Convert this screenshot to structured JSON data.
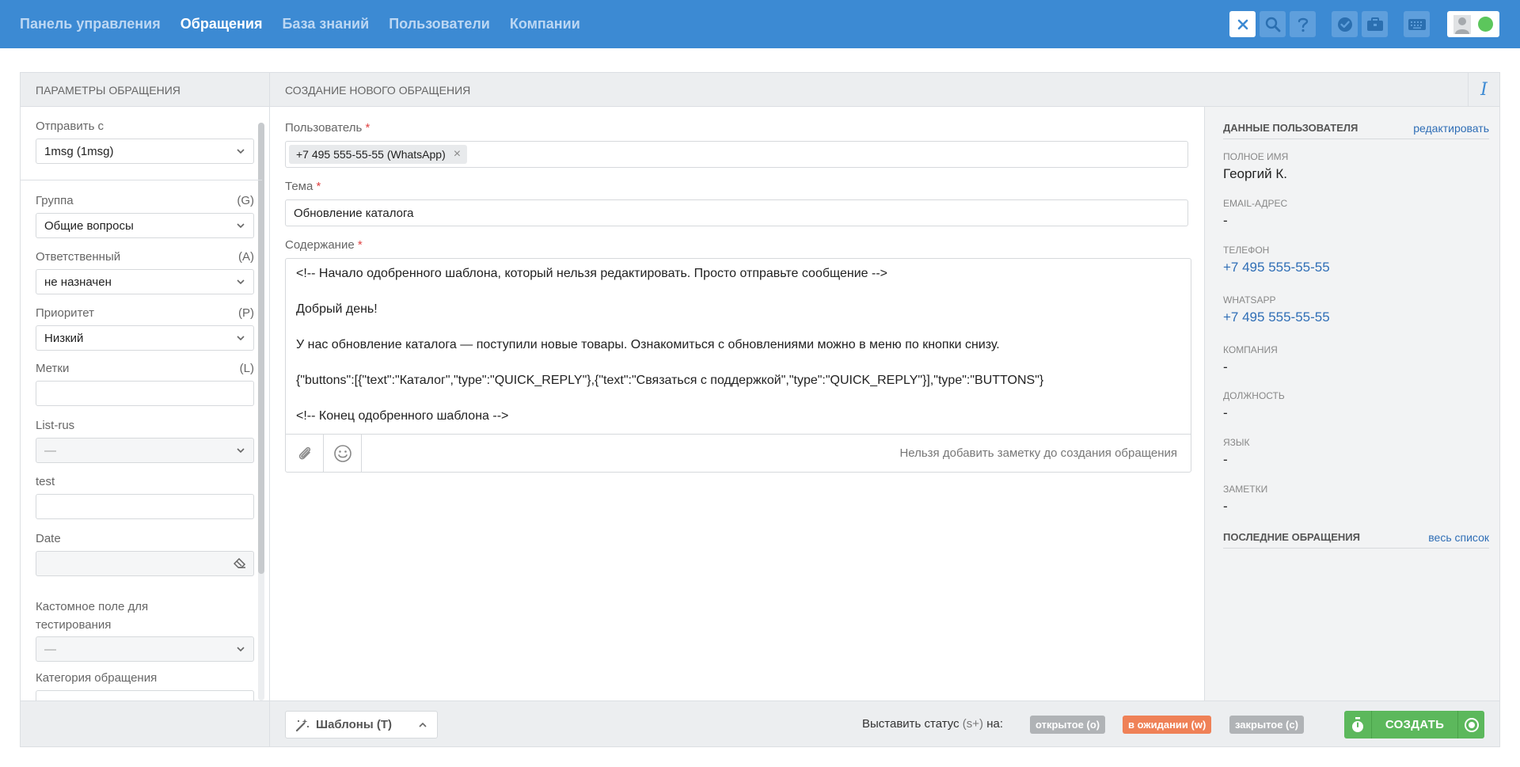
{
  "nav": {
    "items": [
      {
        "label": "Панель управления",
        "active": false
      },
      {
        "label": "Обращения",
        "active": true
      },
      {
        "label": "База знаний",
        "active": false
      },
      {
        "label": "Пользователи",
        "active": false
      },
      {
        "label": "Компании",
        "active": false
      }
    ]
  },
  "toolbar_icons": [
    "close-icon",
    "search-icon",
    "help-icon",
    "check-badge-icon",
    "briefcase-icon",
    "keyboard-icon",
    "avatar-icon"
  ],
  "headers": {
    "left": "Параметры обращения",
    "center": "Создание нового обращения",
    "info": "i"
  },
  "sidebar": {
    "send_from": {
      "label": "Отправить с",
      "value": "1msg (1msg)"
    },
    "group": {
      "label": "Группа",
      "hotkey": "(G)",
      "value": "Общие вопросы"
    },
    "assignee": {
      "label": "Ответственный",
      "hotkey": "(A)",
      "value": "не назначен"
    },
    "priority": {
      "label": "Приоритет",
      "hotkey": "(P)",
      "value": "Низкий"
    },
    "tags": {
      "label": "Метки",
      "hotkey": "(L)",
      "value": ""
    },
    "list_rus": {
      "label": "List-rus",
      "value": "—"
    },
    "test": {
      "label": "test",
      "value": ""
    },
    "date": {
      "label": "Date",
      "value": ""
    },
    "custom_field": {
      "label": "Кастомное поле для тестирования",
      "value": "—"
    },
    "category": {
      "label": "Категория обращения"
    }
  },
  "form": {
    "user_label": "Пользователь",
    "required_mark": "*",
    "user_token": "+7 495 555-55-55 (WhatsApp)",
    "token_remove": "×",
    "subject_label": "Тема",
    "subject_value": "Обновление каталога",
    "content_label": "Содержание",
    "content_lines": [
      "<!-- Начало одобренного шаблона, который нельзя редактировать. Просто отправьте сообщение -->",
      "Добрый день!",
      "У нас обновление каталога — поступили новые товары. Ознакомиться с обновлениями можно в меню по кнопки снизу.",
      "{\"buttons\":[{\"text\":\"Каталог\",\"type\":\"QUICK_REPLY\"},{\"text\":\"Связаться с поддержкой\",\"type\":\"QUICK_REPLY\"}],\"type\":\"BUTTONS\"}",
      "<!-- Конец одобренного шаблона -->"
    ],
    "note_disabled": "Нельзя добавить заметку до создания обращения"
  },
  "user_data": {
    "title": "Данные пользователя",
    "edit_link": "редактировать",
    "fields": [
      {
        "key": "Полное имя",
        "value": "Георгий К.",
        "link": false
      },
      {
        "key": "Email-адрес",
        "value": "-",
        "link": false
      },
      {
        "key": "Телефон",
        "value": "+7 495 555-55-55",
        "link": true
      },
      {
        "key": "WhatsApp",
        "value": "+7 495 555-55-55",
        "link": true
      },
      {
        "key": "Компания",
        "value": "-",
        "link": false
      },
      {
        "key": "Должность",
        "value": "-",
        "link": false
      },
      {
        "key": "Язык",
        "value": "-",
        "link": false
      },
      {
        "key": "Заметки",
        "value": "-",
        "link": false
      }
    ],
    "add_label": "+",
    "recent_title": "Последние обращения",
    "recent_link": "весь список"
  },
  "footer": {
    "templates_label": "Шаблоны (T)",
    "status_prefix": "Выставить статус",
    "status_hotkey": "(s+)",
    "status_suffix": "на:",
    "statuses": [
      {
        "label": "открытое (o)",
        "color": "#b0b3b6"
      },
      {
        "label": "в ожидании (w)",
        "color": "#ef8157"
      },
      {
        "label": "закрытое (c)",
        "color": "#b0b3b6"
      }
    ],
    "create_label": "Создать"
  },
  "colors": {
    "brand": "#3c8ad3",
    "create": "#5cb85c",
    "link": "#2f6eb6",
    "online": "#5cc65c"
  }
}
